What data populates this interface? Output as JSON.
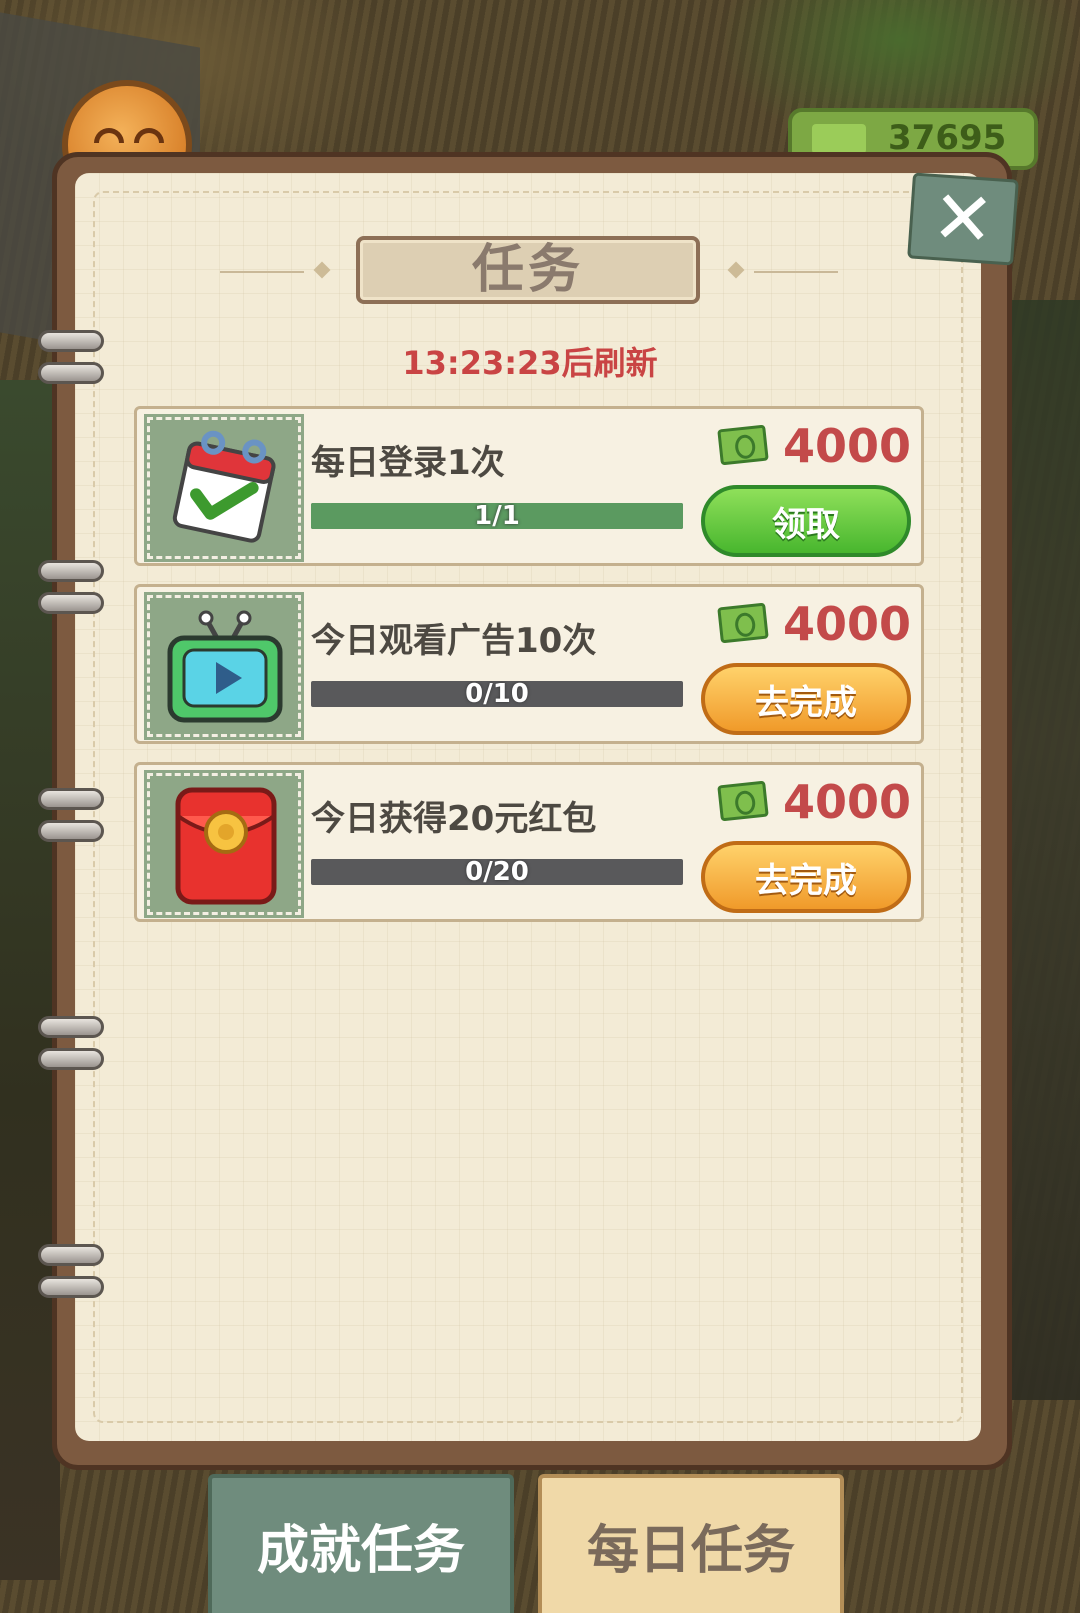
{
  "hud": {
    "money": "37695"
  },
  "panel": {
    "title": "任务",
    "refresh_text": "13:23:23后刷新",
    "close_label": "✕"
  },
  "tasks": [
    {
      "title": "每日登录1次",
      "progress_text": "1/1",
      "progress": 1.0,
      "reward": "4000",
      "button": "领取",
      "button_style": "green",
      "icon": "calendar-check-icon"
    },
    {
      "title": "今日观看广告10次",
      "progress_text": "0/10",
      "progress": 0.0,
      "reward": "4000",
      "button": "去完成",
      "button_style": "orange",
      "icon": "tv-play-icon"
    },
    {
      "title": "今日获得20元红包",
      "progress_text": "0/20",
      "progress": 0.0,
      "reward": "4000",
      "button": "去完成",
      "button_style": "orange",
      "icon": "red-envelope-icon"
    }
  ],
  "tabs": [
    {
      "label": "成就任务",
      "active": false
    },
    {
      "label": "每日任务",
      "active": true
    }
  ],
  "colors": {
    "reward": "#c34a4a",
    "refresh": "#c94444",
    "progress_fill": "#5b9a60"
  }
}
